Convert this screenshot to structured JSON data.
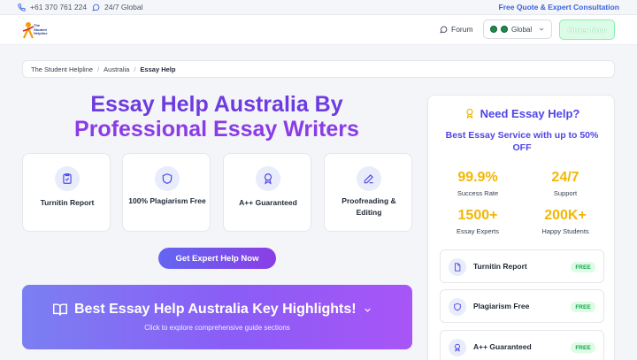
{
  "topbar": {
    "phone": "+61 370 761 224",
    "availability": "24/7 Global",
    "quote_link": "Free Quote & Expert Consultation"
  },
  "header": {
    "logo_text": "The Student Helpline",
    "forum": "Forum",
    "region": "Global",
    "order_button": "Order Now"
  },
  "breadcrumb": [
    "The Student Helpline",
    "Australia",
    "Essay Help"
  ],
  "hero": {
    "title_line1": "Essay Help Australia By",
    "title_line2": "Professional Essay Writers",
    "features": [
      {
        "label": "Turnitin Report",
        "icon": "clipboard-check-icon"
      },
      {
        "label": "100% Plagiarism Free",
        "icon": "shield-icon"
      },
      {
        "label": "A++ Guaranteed",
        "icon": "award-icon"
      },
      {
        "label": "Proofreading & Editing",
        "icon": "pen-icon"
      }
    ],
    "cta": "Get Expert Help Now"
  },
  "highlights": {
    "title": "Best Essay Help Australia Key Highlights!",
    "subtitle": "Click to explore comprehensive guide sections"
  },
  "side": {
    "heading": "Need Essay Help?",
    "subheading": "Best Essay Service with up to 50% OFF",
    "stats": [
      {
        "value": "99.9%",
        "caption": "Success Rate"
      },
      {
        "value": "24/7",
        "caption": "Support"
      },
      {
        "value": "1500+",
        "caption": "Essay Experts"
      },
      {
        "value": "200K+",
        "caption": "Happy Students"
      }
    ],
    "services": [
      {
        "name": "Turnitin Report",
        "tag": "FREE"
      },
      {
        "name": "Plagiarism Free",
        "tag": "FREE"
      },
      {
        "name": "A++ Guaranteed",
        "tag": "FREE"
      }
    ]
  },
  "colors": {
    "accent": "#4f46e5",
    "title_purple": "#6d3be0",
    "stat_gold": "#f2b705",
    "free_green": "#16a34a"
  }
}
